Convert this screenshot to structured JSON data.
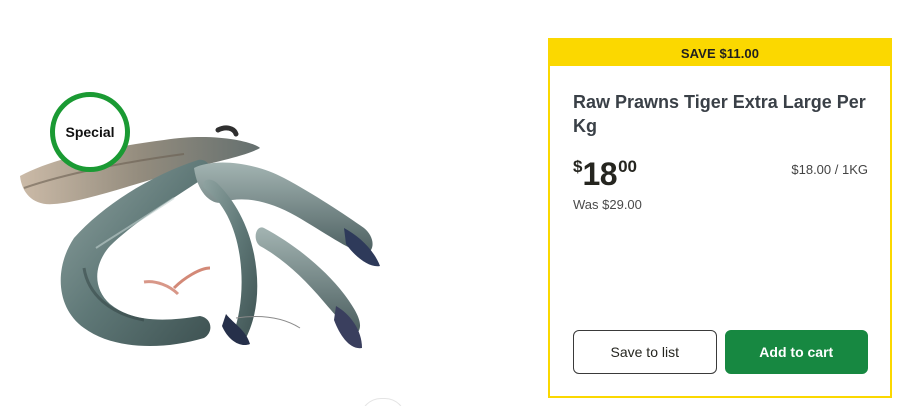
{
  "product": {
    "image_alt": "Raw tiger prawns",
    "roundel_label": "Special",
    "roundel_color": "#1a9a33"
  },
  "offer": {
    "save_label": "SAVE $11.00",
    "banner_color": "#fbd800",
    "title": "Raw Prawns Tiger Extra Large Per Kg",
    "price": {
      "currency_symbol": "$",
      "dollars": "18",
      "cents": "00"
    },
    "unit_price": "$18.00 / 1KG",
    "was_price": "Was $29.00"
  },
  "actions": {
    "save_to_list_label": "Save to list",
    "add_to_cart_label": "Add to cart",
    "primary_color": "#178841"
  }
}
